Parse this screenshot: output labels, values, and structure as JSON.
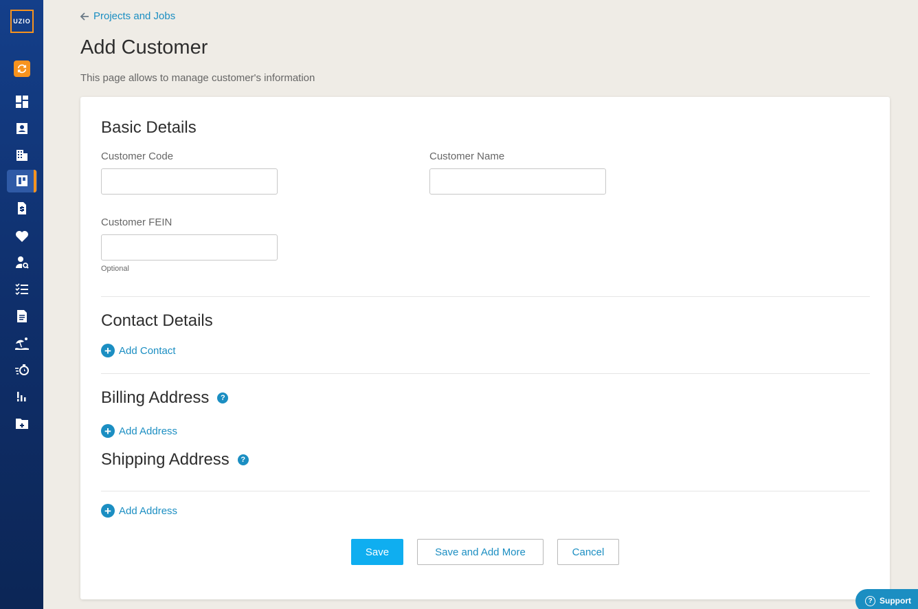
{
  "sidebar": {
    "logo_text": "UZIO",
    "icons": [
      "sync-icon",
      "dashboard-icon",
      "contact-card-icon",
      "building-icon",
      "projects-board-icon",
      "invoice-dollar-icon",
      "heart-icon",
      "user-search-icon",
      "checklist-icon",
      "document-icon",
      "vacation-beach-icon",
      "timer-icon",
      "reports-chart-icon",
      "folder-add-icon"
    ],
    "active_item": "projects-board-icon",
    "accent_color": "#f7931e"
  },
  "header": {
    "breadcrumb": "Projects and Jobs",
    "title": "Add Customer",
    "subtitle": "This page allows to manage customer's information"
  },
  "form": {
    "basic_details": {
      "title": "Basic Details",
      "customer_code_label": "Customer Code",
      "customer_code_value": "",
      "customer_name_label": "Customer Name",
      "customer_name_value": "",
      "customer_fein_label": "Customer FEIN",
      "customer_fein_value": "",
      "customer_fein_hint": "Optional"
    },
    "contact_details": {
      "title": "Contact Details",
      "add_label": "Add Contact"
    },
    "billing_address": {
      "title": "Billing Address",
      "help": "?",
      "add_label": "Add Address"
    },
    "shipping_address": {
      "title": "Shipping Address",
      "help": "?",
      "add_label": "Add Address"
    },
    "buttons": {
      "save": "Save",
      "save_add_more": "Save and Add More",
      "cancel": "Cancel"
    }
  },
  "support": {
    "label": "Support"
  },
  "colors": {
    "link": "#1b8ec2",
    "primary_button": "#0faef0",
    "sidebar": "#143f8a",
    "background": "#efece6"
  }
}
